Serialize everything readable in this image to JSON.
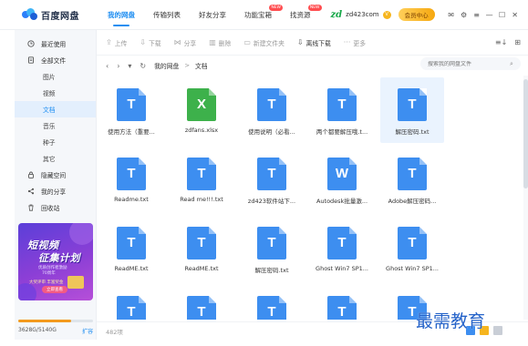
{
  "app": {
    "name": "百度网盘",
    "brand_color": "#1f8ef1"
  },
  "nav": {
    "items": [
      {
        "label": "我的网盘",
        "active": true,
        "badge": ""
      },
      {
        "label": "传输列表",
        "active": false,
        "badge": ""
      },
      {
        "label": "好友分享",
        "active": false,
        "badge": ""
      },
      {
        "label": "功能宝箱",
        "active": false,
        "badge": "NEW"
      },
      {
        "label": "找资源",
        "active": false,
        "badge": "NEW"
      }
    ]
  },
  "user": {
    "logo_text": "zd",
    "name": "zd423com",
    "vip_mark": "V",
    "member_label": "会员中心"
  },
  "window_controls": {
    "mail": "✉",
    "settings": "⚙",
    "menu": "≡",
    "minimize": "—",
    "maximize": "☐",
    "close": "✕"
  },
  "sidebar": {
    "items": [
      {
        "label": "最近使用",
        "icon": "clock-icon"
      },
      {
        "label": "全部文件",
        "icon": "file-icon"
      }
    ],
    "sub_items": [
      {
        "label": "图片",
        "active": false
      },
      {
        "label": "视频",
        "active": false
      },
      {
        "label": "文档",
        "active": true
      },
      {
        "label": "音乐",
        "active": false
      },
      {
        "label": "种子",
        "active": false
      },
      {
        "label": "其它",
        "active": false
      }
    ],
    "bottom_items": [
      {
        "label": "隐藏空间",
        "icon": "lock-icon"
      },
      {
        "label": "我的分享",
        "icon": "share-icon"
      },
      {
        "label": "回收站",
        "icon": "trash-icon"
      }
    ],
    "promo": {
      "line1": "短视频",
      "line2": "征集计划",
      "line3": "优质创作者激励",
      "line4": "70周年",
      "line5": "大奖评审 丰富奖金",
      "button": "立即查看"
    },
    "quota": {
      "text": "3628G/5140G",
      "used_fraction": 0.706,
      "expand": "扩容"
    }
  },
  "toolbar": {
    "buttons": [
      {
        "label": "上传",
        "glyph": "⇪",
        "primary": false
      },
      {
        "label": "下载",
        "glyph": "⇩",
        "primary": false
      },
      {
        "label": "分享",
        "glyph": "⋈",
        "primary": false
      },
      {
        "label": "删除",
        "glyph": "▥",
        "primary": false
      },
      {
        "label": "新建文件夹",
        "glyph": "▭",
        "primary": false
      },
      {
        "label": "离线下载",
        "glyph": "⇩",
        "primary": true
      },
      {
        "label": "更多",
        "glyph": "···",
        "primary": false
      }
    ],
    "sort_glyph": "≡↓",
    "view_glyph": "⊞"
  },
  "path": {
    "back": "‹",
    "forward": "›",
    "dropdown": "▾",
    "refresh": "↻",
    "crumbs": [
      "我的网盘",
      "文档"
    ],
    "separator": ">"
  },
  "search": {
    "placeholder": "搜索我的网盘文件",
    "icon": "⌕"
  },
  "files": [
    {
      "name": "使用方法（重要...",
      "letter": "T",
      "color": "#3d8ef0",
      "selected": false
    },
    {
      "name": "zdfans.xlsx",
      "letter": "X",
      "color": "#3db14b",
      "selected": false
    },
    {
      "name": "使用说明（必看...",
      "letter": "T",
      "color": "#3d8ef0",
      "selected": false
    },
    {
      "name": "两个都要解压哦.t...",
      "letter": "T",
      "color": "#3d8ef0",
      "selected": false
    },
    {
      "name": "解压密码.txt",
      "letter": "T",
      "color": "#3d8ef0",
      "selected": true
    },
    {
      "name": "Readme.txt",
      "letter": "T",
      "color": "#3d8ef0",
      "selected": false
    },
    {
      "name": "Read me!!!.txt",
      "letter": "T",
      "color": "#3d8ef0",
      "selected": false
    },
    {
      "name": "zd423软件站下...",
      "letter": "T",
      "color": "#3d8ef0",
      "selected": false
    },
    {
      "name": "Autodesk批量激...",
      "letter": "W",
      "color": "#3d8ef0",
      "selected": false
    },
    {
      "name": "Adobe解压密码...",
      "letter": "T",
      "color": "#3d8ef0",
      "selected": false
    },
    {
      "name": "ReadME.txt",
      "letter": "T",
      "color": "#3d8ef0",
      "selected": false
    },
    {
      "name": "ReadME.txt",
      "letter": "T",
      "color": "#3d8ef0",
      "selected": false
    },
    {
      "name": "解压密码.txt",
      "letter": "T",
      "color": "#3d8ef0",
      "selected": false
    },
    {
      "name": "Ghost Win7 SP1...",
      "letter": "T",
      "color": "#3d8ef0",
      "selected": false
    },
    {
      "name": "Ghost Win7 SP1...",
      "letter": "T",
      "color": "#3d8ef0",
      "selected": false
    },
    {
      "name": "",
      "letter": "T",
      "color": "#3d8ef0",
      "selected": false
    },
    {
      "name": "",
      "letter": "T",
      "color": "#3d8ef0",
      "selected": false
    },
    {
      "name": "",
      "letter": "T",
      "color": "#3d8ef0",
      "selected": false
    },
    {
      "name": "",
      "letter": "T",
      "color": "#3d8ef0",
      "selected": false
    },
    {
      "name": "",
      "letter": "T",
      "color": "#3d8ef0",
      "selected": false
    }
  ],
  "status": {
    "count": "482项"
  },
  "watermark": "最需教育"
}
